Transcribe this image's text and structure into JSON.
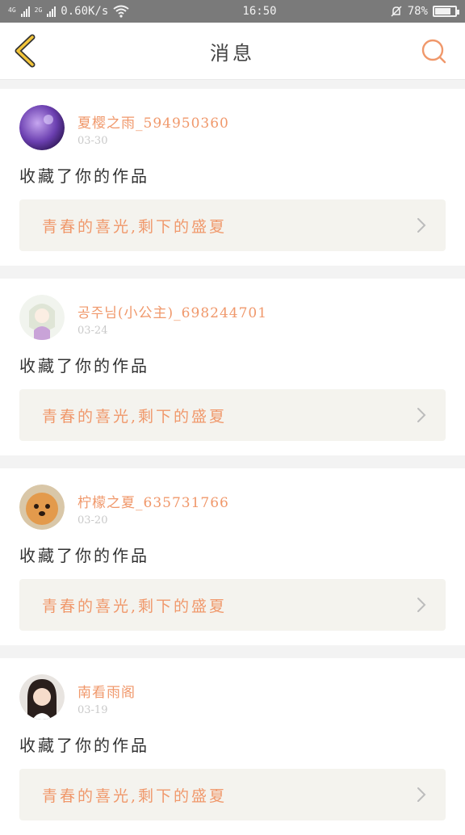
{
  "status_bar": {
    "net_label_1": "4G",
    "net_label_2": "2G",
    "speed": "0.60K/s",
    "time": "16:50",
    "battery": "78%",
    "battery_level": 0.78,
    "icons": [
      "signal-icon",
      "wifi-icon",
      "mute-icon",
      "battery-icon"
    ]
  },
  "header": {
    "title": "消息",
    "back_icon": "chevron-left-icon",
    "search_icon": "search-icon",
    "accent": "#f0986b",
    "back_color": "#f3c53a"
  },
  "messages": [
    {
      "username": "夏樱之雨_594950360",
      "date": "03-30",
      "action": "收藏了你的作品",
      "work_title": "青春的喜光,剩下的盛夏"
    },
    {
      "username": "공주님(小公主)_698244701",
      "date": "03-24",
      "action": "收藏了你的作品",
      "work_title": "青春的喜光,剩下的盛夏"
    },
    {
      "username": "柠檬之夏_635731766",
      "date": "03-20",
      "action": "收藏了你的作品",
      "work_title": "青春的喜光,剩下的盛夏"
    },
    {
      "username": "南看雨阁",
      "date": "03-19",
      "action": "收藏了你的作品",
      "work_title": "青春的喜光,剩下的盛夏"
    }
  ]
}
